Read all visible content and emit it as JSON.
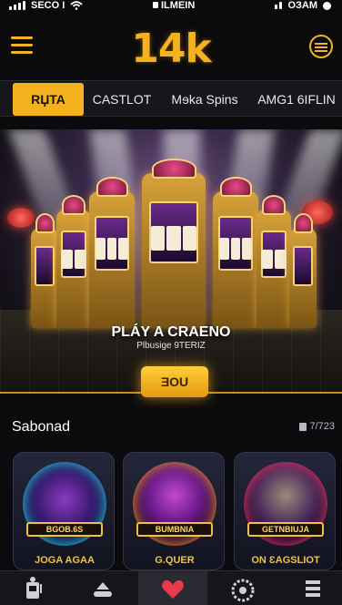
{
  "status_bar": {
    "carrier": "SECO I",
    "center": "ILMEIN",
    "right": "OЗAM"
  },
  "header": {
    "logo": "14k",
    "menu_icon": "hamburger-menu-icon",
    "profile_icon": "profile-icon"
  },
  "tabs": [
    {
      "label": "RЏTA",
      "active": true
    },
    {
      "label": "CASTLOT",
      "active": false
    },
    {
      "label": "Mɘka Spins",
      "active": false
    },
    {
      "label": "AMG1 6IFLIN",
      "active": false
    }
  ],
  "hero": {
    "title": "PLÁY A CRAENO",
    "subtitle": "Plbusige 9TERIZ",
    "cta_label": "ƎOU"
  },
  "section": {
    "title": "Sabonad",
    "count": "7/723"
  },
  "cards": [
    {
      "plate": "BGOB.6S",
      "caption": "JOGA AGAA"
    },
    {
      "plate": "BUMBNIA",
      "caption": "G.QUER"
    },
    {
      "plate": "GETNBIUJA",
      "caption": "ON ƐAGSLIOT"
    }
  ],
  "bottom_nav": [
    {
      "icon": "slot-machine-icon",
      "active": false
    },
    {
      "icon": "casino-table-icon",
      "active": false
    },
    {
      "icon": "heart-icon",
      "active": true
    },
    {
      "icon": "roulette-icon",
      "active": false
    },
    {
      "icon": "list-icon",
      "active": false
    }
  ],
  "colors": {
    "accent": "#f4b21e",
    "background": "#0b0b0d",
    "tab_bar": "#17171b",
    "heart": "#e83a4a"
  }
}
